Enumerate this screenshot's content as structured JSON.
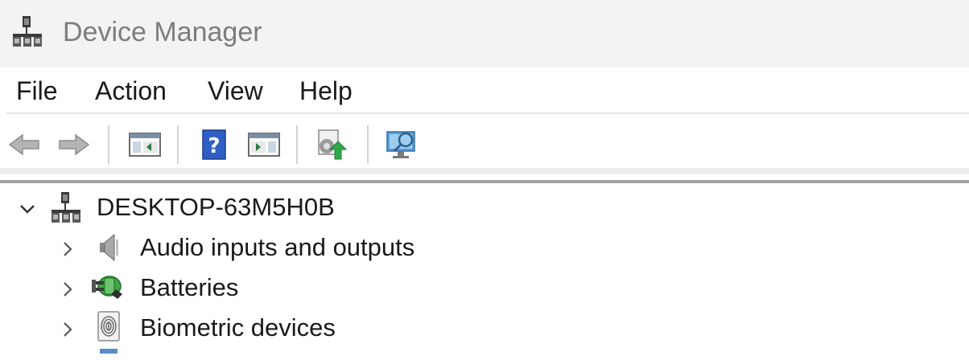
{
  "window": {
    "title": "Device Manager"
  },
  "menu": {
    "items": [
      {
        "label": "File"
      },
      {
        "label": "Action"
      },
      {
        "label": "View"
      },
      {
        "label": "Help"
      }
    ]
  },
  "toolbar": {
    "buttons": [
      {
        "icon": "back-arrow-icon"
      },
      {
        "icon": "forward-arrow-icon"
      },
      {
        "icon": "show-hide-console-tree-icon"
      },
      {
        "icon": "help-icon"
      },
      {
        "icon": "show-hide-action-pane-icon"
      },
      {
        "icon": "update-driver-icon"
      },
      {
        "icon": "scan-hardware-changes-icon"
      }
    ]
  },
  "tree": {
    "root": {
      "label": "DESKTOP-63M5H0B",
      "icon": "computer-icon",
      "expanded": true
    },
    "children": [
      {
        "label": "Audio inputs and outputs",
        "icon": "speaker-icon"
      },
      {
        "label": "Batteries",
        "icon": "battery-icon"
      },
      {
        "label": "Biometric devices",
        "icon": "fingerprint-icon"
      }
    ]
  }
}
